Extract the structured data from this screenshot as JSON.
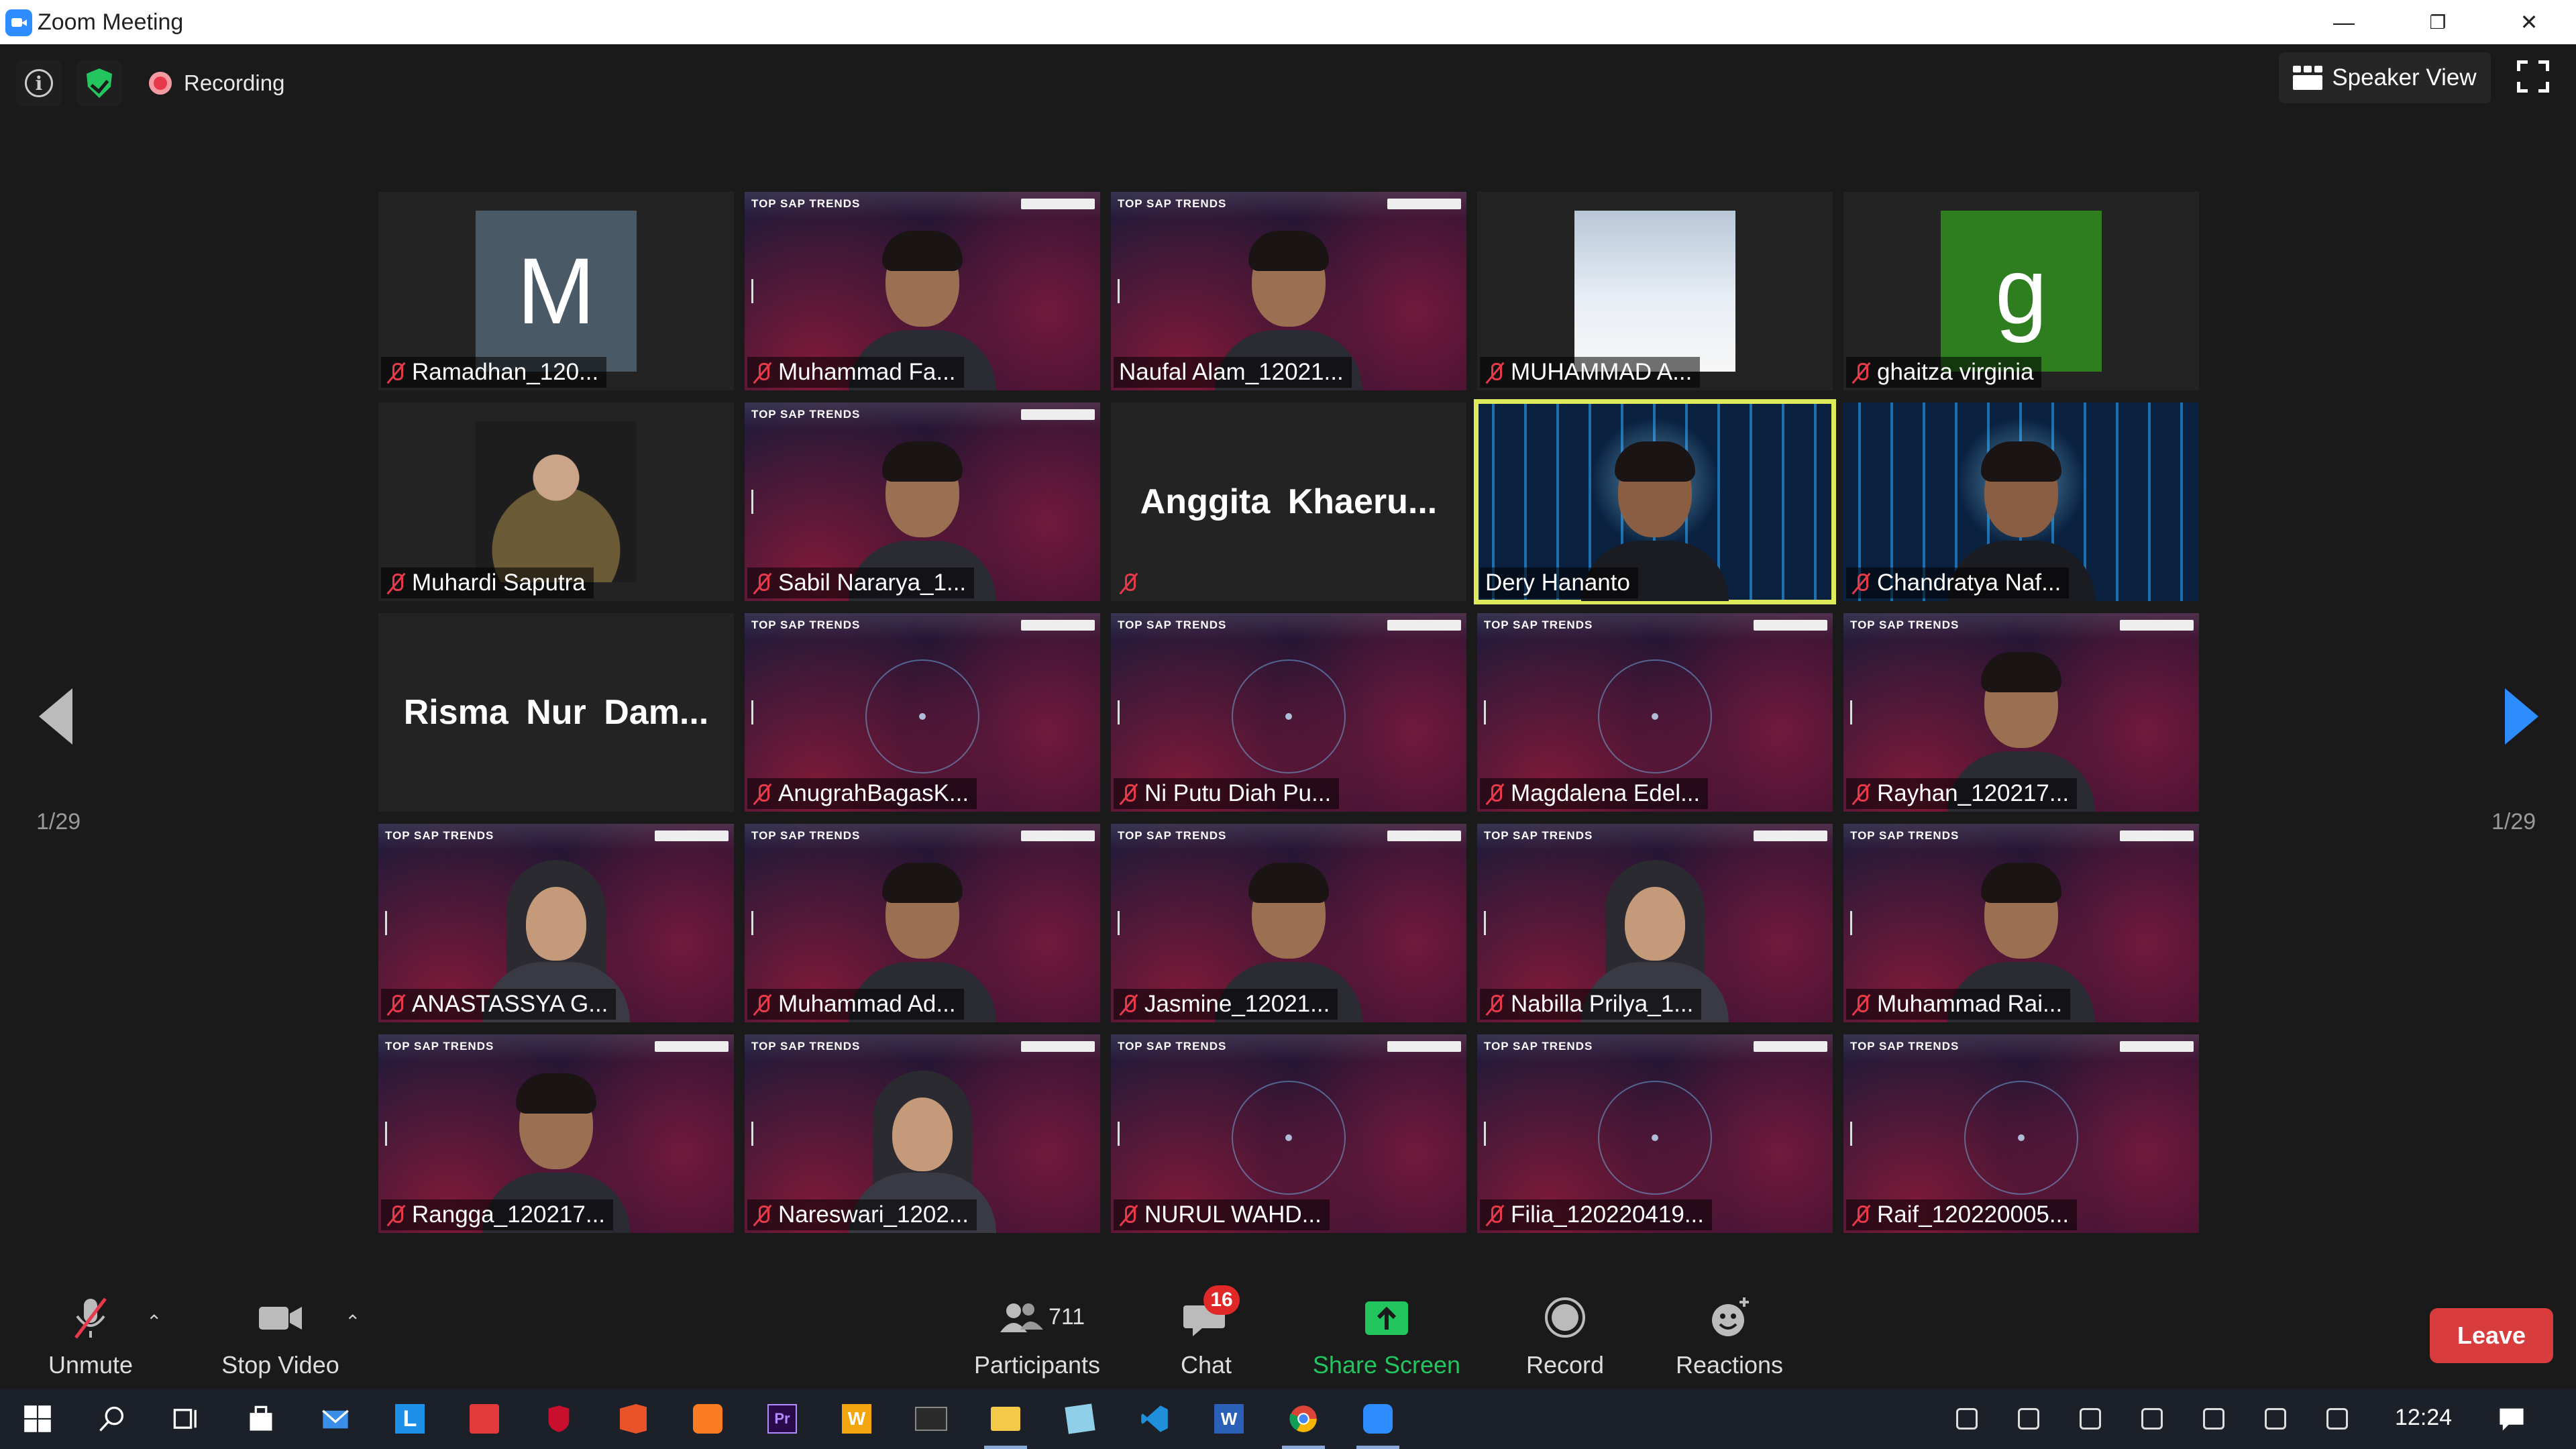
{
  "window": {
    "title": "Zoom Meeting",
    "minimize": "—",
    "restore": "❐",
    "close": "✕"
  },
  "topbar": {
    "recording_label": "Recording",
    "speaker_view_label": "Speaker View"
  },
  "pagination": {
    "left": "1/29",
    "right": "1/29"
  },
  "tiles": [
    {
      "name": "Ramadhan_120...",
      "kind": "avatar",
      "letter": "M",
      "avatar_color": "#4a5966",
      "muted": true
    },
    {
      "name": "Muhammad Fa...",
      "kind": "video-red",
      "muted": true
    },
    {
      "name": "Naufal Alam_12021...",
      "kind": "video-red",
      "muted": false
    },
    {
      "name": "MUHAMMAD A...",
      "kind": "photo-sky",
      "muted": true
    },
    {
      "name": "ghaitza virginia",
      "kind": "avatar",
      "letter": "g",
      "avatar_color": "#2e7d1e",
      "muted": true
    },
    {
      "name": "Muhardi Saputra",
      "kind": "photo-dark",
      "muted": true
    },
    {
      "name": "Sabil Nararya_1...",
      "kind": "video-red",
      "muted": true
    },
    {
      "name": "",
      "kind": "text",
      "big_name": "Anggita  Khaeru...",
      "muted": true
    },
    {
      "name": "Dery Hananto",
      "kind": "video-blue",
      "muted": false,
      "active": true
    },
    {
      "name": "Chandratya Naf...",
      "kind": "video-blue",
      "muted": true
    },
    {
      "name": "",
      "kind": "text",
      "big_name": "Risma  Nur  Dam...",
      "muted": false
    },
    {
      "name": "AnugrahBagasK...",
      "kind": "bg-red",
      "muted": true
    },
    {
      "name": "Ni Putu Diah Pu...",
      "kind": "bg-red",
      "muted": true
    },
    {
      "name": "Magdalena Edel...",
      "kind": "bg-red",
      "muted": true
    },
    {
      "name": "Rayhan_120217...",
      "kind": "video-red",
      "muted": true
    },
    {
      "name": "ANASTASSYA G...",
      "kind": "video-red-hijab",
      "muted": true
    },
    {
      "name": "Muhammad Ad...",
      "kind": "video-red",
      "muted": true
    },
    {
      "name": "Jasmine_12021...",
      "kind": "video-red",
      "muted": true
    },
    {
      "name": "Nabilla Prilya_1...",
      "kind": "video-red-hijab",
      "muted": true
    },
    {
      "name": "Muhammad Rai...",
      "kind": "video-red",
      "muted": true
    },
    {
      "name": "Rangga_120217...",
      "kind": "video-red",
      "muted": true
    },
    {
      "name": "Nareswari_1202...",
      "kind": "video-red-hijab",
      "muted": true
    },
    {
      "name": "NURUL WAHD...",
      "kind": "bg-red",
      "muted": true
    },
    {
      "name": "Filia_120220419...",
      "kind": "bg-red",
      "muted": true
    },
    {
      "name": "Raif_120220005...",
      "kind": "bg-red",
      "muted": true
    }
  ],
  "banner_text": "TOP SAP TRENDS",
  "toolbar": {
    "unmute_label": "Unmute",
    "stop_video_label": "Stop Video",
    "participants_label": "Participants",
    "participants_count": "711",
    "chat_label": "Chat",
    "chat_badge": "16",
    "share_screen_label": "Share Screen",
    "record_label": "Record",
    "reactions_label": "Reactions",
    "leave_label": "Leave"
  },
  "colors": {
    "accent_blue": "#2d8cff",
    "share_green": "#23c55e",
    "leave_red": "#d93c3c",
    "active_speaker": "#e0eb5b"
  },
  "taskbar": {
    "icons": [
      "windows-icon",
      "search-icon",
      "task-view-icon",
      "store-icon",
      "mail-icon",
      "l-app-icon",
      "red-app-icon",
      "mcafee-icon",
      "office-icon",
      "xampp-icon",
      "premiere-icon",
      "wps-icon",
      "mysql-icon",
      "file-explorer-icon",
      "notes-icon",
      "vscode-icon",
      "word-icon",
      "chrome-icon",
      "zoom-icon"
    ],
    "clock": "12:24"
  }
}
